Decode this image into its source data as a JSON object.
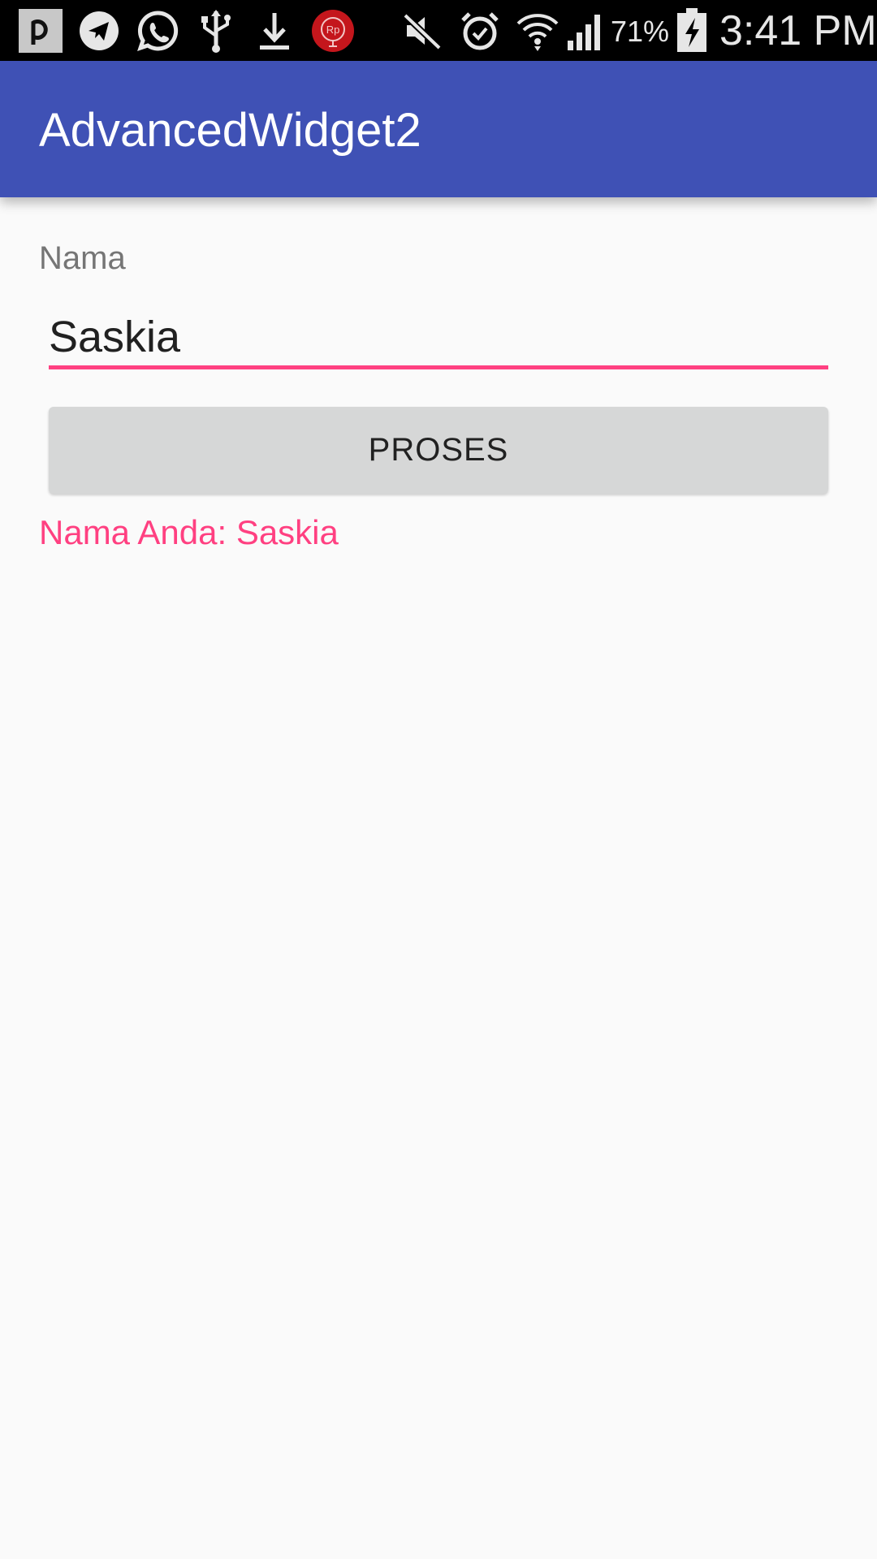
{
  "status_bar": {
    "icons": [
      "app-p-icon",
      "telegram-icon",
      "whatsapp-icon",
      "usb-icon",
      "download-icon",
      "rp-app-icon",
      "mute-icon",
      "alarm-icon",
      "wifi-icon",
      "signal-icon",
      "battery-charging-icon"
    ],
    "battery_percent": "71%",
    "time": "3:41 PM"
  },
  "app_bar": {
    "title": "AdvancedWidget2",
    "color": "#3f51b5"
  },
  "form": {
    "name_label": "Nama",
    "name_value": "Saskia",
    "button_label": "PROSES",
    "result": "Nama Anda: Saskia"
  },
  "colors": {
    "primary": "#3f51b5",
    "accent": "#ff4081",
    "background": "#fafafa",
    "button": "#d6d7d7"
  }
}
